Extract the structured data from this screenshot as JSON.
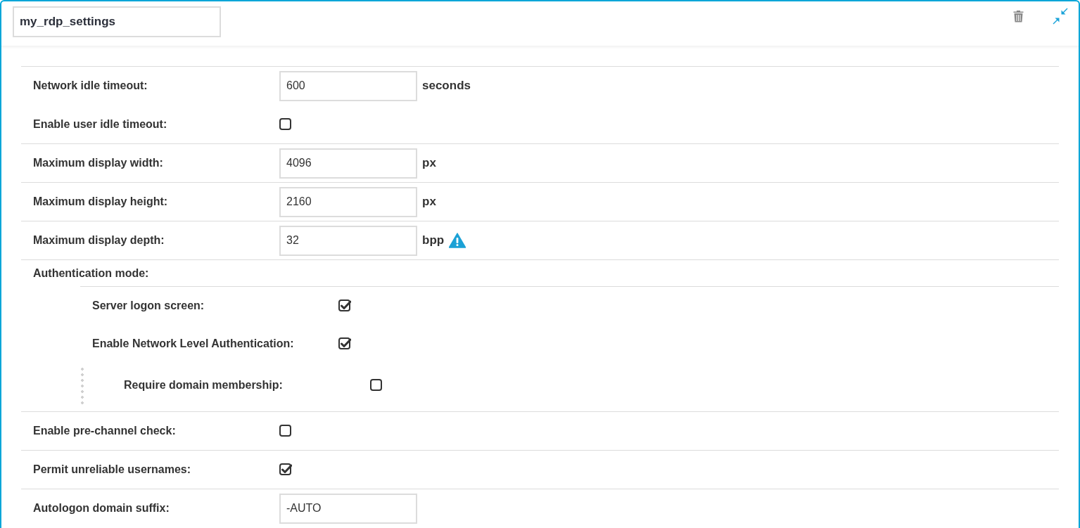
{
  "name_field": {
    "value": "my_rdp_settings"
  },
  "settings": [
    {
      "kind": "text",
      "label": "Network idle timeout:",
      "value": "600",
      "unit": "seconds",
      "warning": false,
      "divider_above": true
    },
    {
      "kind": "checkbox",
      "label": "Enable user idle timeout:",
      "checked": false,
      "divider_above": false
    },
    {
      "kind": "text",
      "label": "Maximum display width:",
      "value": "4096",
      "unit": "px",
      "warning": false,
      "divider_above": true
    },
    {
      "kind": "text",
      "label": "Maximum display height:",
      "value": "2160",
      "unit": "px",
      "warning": false,
      "divider_above": true
    },
    {
      "kind": "text",
      "label": "Maximum display depth:",
      "value": "32",
      "unit": "bpp",
      "warning": true,
      "divider_above": true
    },
    {
      "kind": "group",
      "label": "Authentication mode:",
      "divider_above": true,
      "children": [
        {
          "kind": "checkbox",
          "label": "Server logon screen:",
          "checked": true
        },
        {
          "kind": "checkbox",
          "label": "Enable Network Level Authentication:",
          "checked": true,
          "children": [
            {
              "kind": "checkbox",
              "label": "Require domain membership:",
              "checked": false
            }
          ]
        }
      ]
    },
    {
      "kind": "checkbox",
      "label": "Enable pre-channel check:",
      "checked": false,
      "divider_above": true
    },
    {
      "kind": "checkbox",
      "label": "Permit unreliable usernames:",
      "checked": true,
      "divider_above": true
    },
    {
      "kind": "text",
      "label": "Autologon domain suffix:",
      "value": "-AUTO",
      "warning": false,
      "divider_above": true
    }
  ]
}
